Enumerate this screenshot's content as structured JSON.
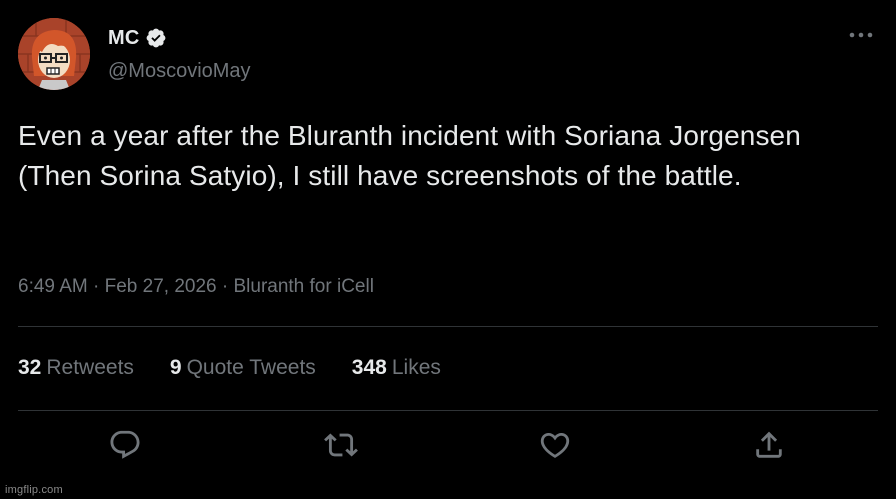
{
  "author": {
    "name": "MC",
    "handle": "@MoscovioMay",
    "verified": true,
    "avatar_icon": "avatar-red-haired-character-with-glasses"
  },
  "tweet": {
    "text": "Even a year after the Bluranth incident with Soriana Jorgensen (Then Sorina Satyio), I still have screenshots of the battle."
  },
  "meta": {
    "time": "6:49 AM",
    "separator1": " · ",
    "date": "Feb 27, 2026",
    "separator2": " · ",
    "source": "Bluranth for iCell"
  },
  "stats": {
    "retweets": {
      "count": "32",
      "label": "Retweets"
    },
    "quote_tweets": {
      "count": "9",
      "label": "Quote Tweets"
    },
    "likes": {
      "count": "348",
      "label": "Likes"
    }
  },
  "actions": [
    "reply-icon",
    "retweet-icon",
    "like-icon",
    "share-icon"
  ],
  "watermark": "imgflip.com",
  "colors": {
    "background": "#000000",
    "primary_text": "#e7e9ea",
    "secondary_text": "#71767b",
    "divider": "#2f3336",
    "verified_badge": "#e7e9ea"
  }
}
